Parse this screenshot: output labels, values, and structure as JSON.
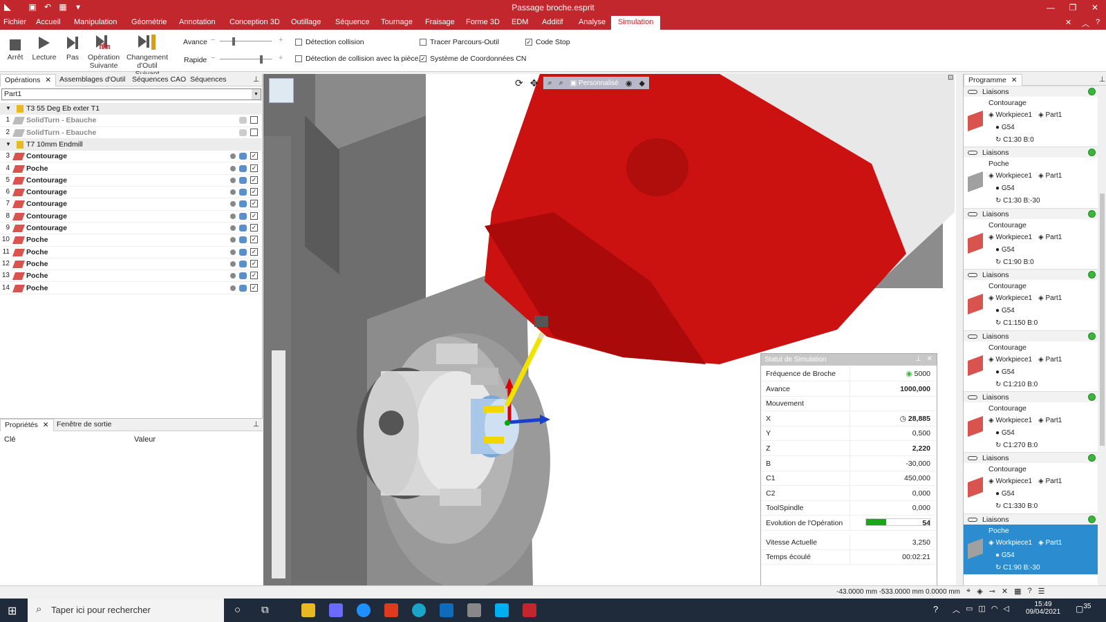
{
  "window": {
    "title": "Passage broche.esprit"
  },
  "menu": {
    "items": [
      "Fichier",
      "Accueil",
      "Manipulation",
      "Géométrie",
      "Annotation",
      "Conception 3D",
      "Outillage",
      "Séquence",
      "Tournage",
      "Fraisage",
      "Forme 3D",
      "EDM",
      "Additif",
      "Analyse",
      "Simulation"
    ],
    "active": "Simulation"
  },
  "ribbon": {
    "stop": "Arrêt",
    "play": "Lecture",
    "step": "Pas",
    "next_op": [
      "Opération",
      "Suivante"
    ],
    "tool_change": [
      "Changement",
      "d'Outil Suivant"
    ],
    "feed_label": "Avance",
    "rapid_label": "Rapide",
    "feed_level": 0.25,
    "rapid_level": 0.82,
    "checks": {
      "collision": {
        "label": "Détection collision",
        "checked": false
      },
      "collision_part": {
        "label": "Détection de collision avec la pièce.",
        "checked": false
      },
      "trace": {
        "label": "Tracer Parcours-Outil",
        "checked": false
      },
      "cn_coords": {
        "label": "Système de Coordonnées CN",
        "checked": true
      },
      "code_stop": {
        "label": "Code Stop",
        "checked": true
      }
    }
  },
  "left": {
    "tabs": [
      "Opérations",
      "Assemblages d'Outil",
      "Séquences CAO",
      "Séquences"
    ],
    "combo": "Part1",
    "rows": [
      {
        "type": "group",
        "num": "",
        "name": "T3 55 Deg Eb exter T1"
      },
      {
        "type": "op",
        "num": "1",
        "name": "SolidTurn - Ebauche",
        "disabled": true
      },
      {
        "type": "op",
        "num": "2",
        "name": "SolidTurn - Ebauche",
        "disabled": true
      },
      {
        "type": "group",
        "num": "",
        "name": "T7 10mm Endmill"
      },
      {
        "type": "op",
        "num": "3",
        "name": "Contourage"
      },
      {
        "type": "op",
        "num": "4",
        "name": "Poche"
      },
      {
        "type": "op",
        "num": "5",
        "name": "Contourage"
      },
      {
        "type": "op",
        "num": "6",
        "name": "Contourage"
      },
      {
        "type": "op",
        "num": "7",
        "name": "Contourage"
      },
      {
        "type": "op",
        "num": "8",
        "name": "Contourage"
      },
      {
        "type": "op",
        "num": "9",
        "name": "Contourage"
      },
      {
        "type": "op",
        "num": "10",
        "name": "Poche"
      },
      {
        "type": "op",
        "num": "11",
        "name": "Poche"
      },
      {
        "type": "op",
        "num": "12",
        "name": "Poche"
      },
      {
        "type": "op",
        "num": "13",
        "name": "Poche"
      },
      {
        "type": "op",
        "num": "14",
        "name": "Poche"
      }
    ],
    "props_tabs": [
      "Propriétés",
      "Fenêtre de sortie"
    ],
    "props_cols": [
      "Clé",
      "Valeur"
    ]
  },
  "viewport": {
    "view_mode": "Personnalisé"
  },
  "sim": {
    "title": "Statut de Simulation",
    "rows": [
      {
        "k": "Fréquence de Broche",
        "v": "5000"
      },
      {
        "k": "Avance",
        "v": "1000,000",
        "bold": true
      },
      {
        "k": "Mouvement",
        "v": ""
      },
      {
        "k": "X",
        "v": "28,885",
        "bold": true
      },
      {
        "k": "Y",
        "v": "0,500"
      },
      {
        "k": "Z",
        "v": "2,220",
        "bold": true
      },
      {
        "k": "B",
        "v": "-30,000"
      },
      {
        "k": "C1",
        "v": "450,000"
      },
      {
        "k": "C2",
        "v": "0,000"
      },
      {
        "k": "ToolSpindle",
        "v": "0,000"
      },
      {
        "k": "Evolution de l'Opération",
        "v": "54"
      },
      {
        "k": "Vitesse Actuelle",
        "v": "3,250"
      },
      {
        "k": "Temps écoulé",
        "v": "00:02:21"
      }
    ],
    "progress": 0.54
  },
  "right": {
    "tab": "Programme",
    "liaison": "Liaisons",
    "cards": [
      {
        "name": "Contourage",
        "wp": "Workpiece1",
        "part": "Part1",
        "g": "G54",
        "c": "C1:30 B:0"
      },
      {
        "name": "Poche",
        "wp": "Workpiece1",
        "part": "Part1",
        "g": "G54",
        "c": "C1:30 B:-30"
      },
      {
        "name": "Contourage",
        "wp": "Workpiece1",
        "part": "Part1",
        "g": "G54",
        "c": "C1:90 B:0"
      },
      {
        "name": "Contourage",
        "wp": "Workpiece1",
        "part": "Part1",
        "g": "G54",
        "c": "C1:150 B:0"
      },
      {
        "name": "Contourage",
        "wp": "Workpiece1",
        "part": "Part1",
        "g": "G54",
        "c": "C1:210 B:0"
      },
      {
        "name": "Contourage",
        "wp": "Workpiece1",
        "part": "Part1",
        "g": "G54",
        "c": "C1:270 B:0"
      },
      {
        "name": "Contourage",
        "wp": "Workpiece1",
        "part": "Part1",
        "g": "G54",
        "c": "C1:330 B:0"
      },
      {
        "name": "Poche",
        "wp": "Workpiece1",
        "part": "Part1",
        "g": "G54",
        "c": "C1:90 B:-30",
        "selected": true
      }
    ]
  },
  "status": {
    "coords": "-43.0000 mm  -533.0000 mm  0.0000 mm"
  },
  "taskbar": {
    "search": "Taper ici pour rechercher",
    "time": "15:49",
    "date": "09/04/2021",
    "notif": "35"
  }
}
